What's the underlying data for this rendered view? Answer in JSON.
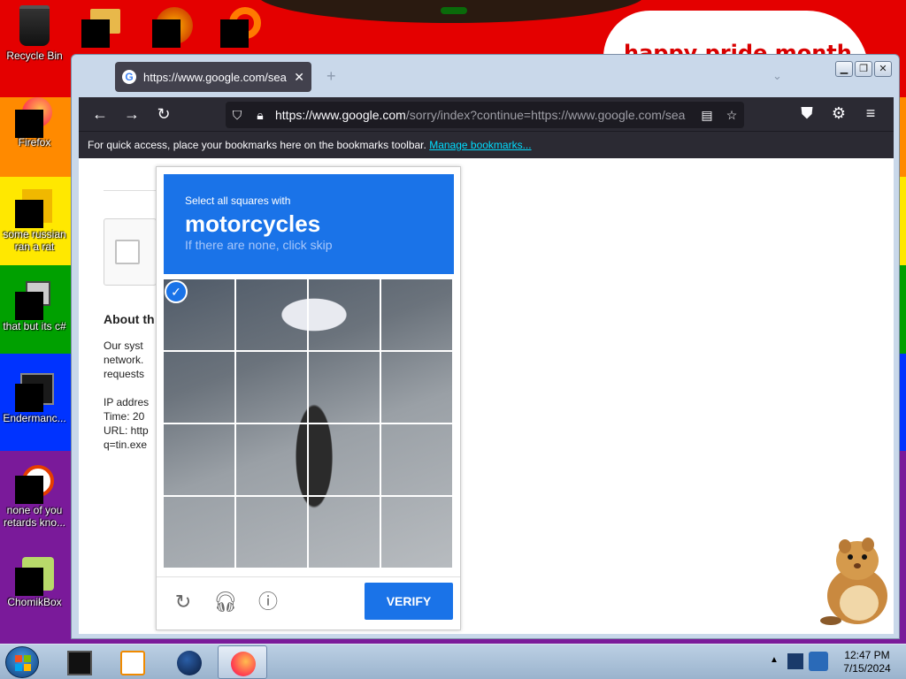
{
  "desktop": {
    "banner_text": "happy pride month",
    "icons": [
      {
        "label": "Recycle Bin"
      },
      {
        "label": "Firefox"
      },
      {
        "label": "some russian ran a rat"
      },
      {
        "label": "that but its c#"
      },
      {
        "label": "Endermanc..."
      },
      {
        "label": "none of you retards kno..."
      },
      {
        "label": "ChomikBox"
      }
    ]
  },
  "browser": {
    "tab_title": "https://www.google.com/search",
    "url_domain": "https://www.google.com",
    "url_rest": "/sorry/index?continue=https://www.google.com/sea",
    "bookmarks_text": "For quick access, place your bookmarks here on the bookmarks toolbar.",
    "bookmarks_link": "Manage bookmarks..."
  },
  "google_page": {
    "heading": "About th",
    "lines": [
      "Our syst",
      "network.",
      "requests",
      "",
      "IP addres",
      "Time: 20",
      "URL: http",
      "q=tin.exe"
    ]
  },
  "captcha": {
    "instruction_small": "Select all squares with",
    "target": "motorcycles",
    "instruction_sub": "If there are none, click skip",
    "verify_label": "VERIFY",
    "grid_size": 4,
    "selected_tiles": [
      0
    ],
    "accent_color": "#1a73e8"
  },
  "taskbar": {
    "time": "12:47 PM",
    "date": "7/15/2024"
  },
  "colors": {
    "taskbar": "#9ab3cd",
    "firefox_toolbar": "#2b2a33"
  }
}
